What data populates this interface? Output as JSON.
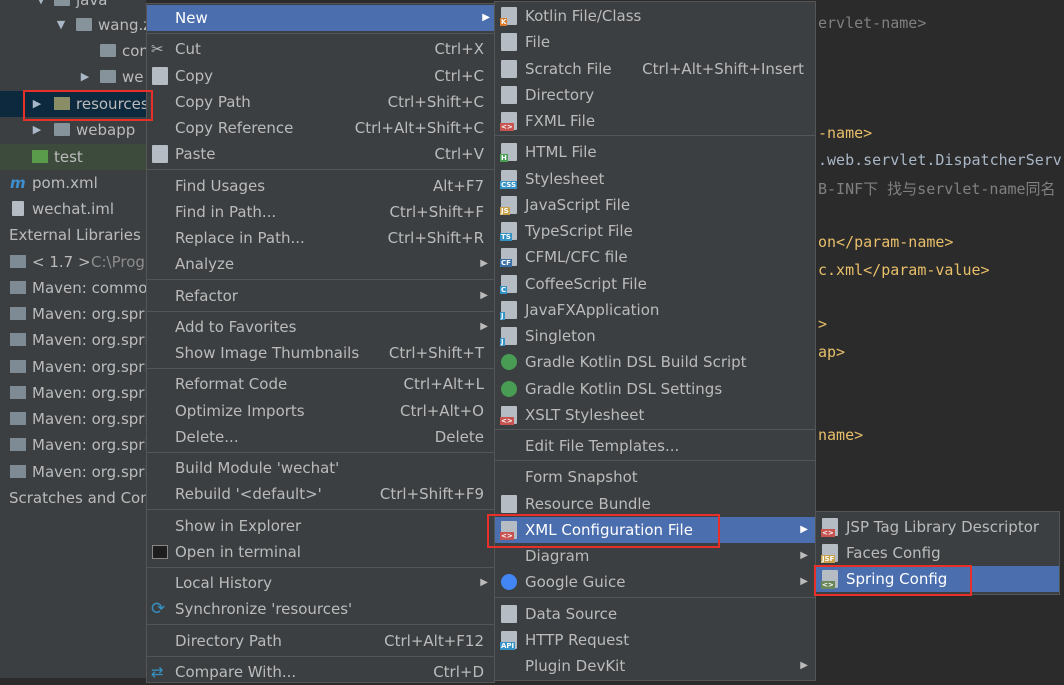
{
  "tree": {
    "rows": [
      {
        "label": "java"
      },
      {
        "label": "wang.z"
      },
      {
        "label": "con"
      },
      {
        "label": "we"
      },
      {
        "label": "resources"
      },
      {
        "label": "webapp"
      },
      {
        "label": "test"
      },
      {
        "label": "pom.xml",
        "prefix": "m"
      },
      {
        "label": "wechat.iml"
      },
      {
        "label": "External Libraries"
      },
      {
        "label": "< 1.7 >",
        "extra": "C:\\Prog"
      },
      {
        "label": "Maven: commo"
      },
      {
        "label": "Maven: org.spri"
      },
      {
        "label": "Maven: org.spri"
      },
      {
        "label": "Maven: org.spri"
      },
      {
        "label": "Maven: org.spri"
      },
      {
        "label": "Maven: org.spri"
      },
      {
        "label": "Maven: org.spri"
      },
      {
        "label": "Maven: org.spri"
      },
      {
        "label": "Scratches and Con"
      }
    ]
  },
  "editor": {
    "lines": [
      {
        "tag": "ervlet-name>",
        "text": ""
      },
      {
        "tag": "-name>",
        "text": ""
      },
      {
        "tag": "",
        "text": ".web.servlet.DispatcherServ"
      },
      {
        "tag": "",
        "text": "B-INF下 找与servlet-name同名"
      },
      {
        "tag": "",
        "text": "on</param-name>"
      },
      {
        "tag": "",
        "text": "c.xml</param-value>"
      },
      {
        "tag": ">",
        "text": ""
      },
      {
        "tag": "ap>",
        "text": ""
      },
      {
        "tag": "name>",
        "text": ""
      }
    ]
  },
  "context_menu": {
    "items": [
      {
        "label": "New",
        "shortcut": "",
        "submenu": true,
        "icon": ""
      },
      {
        "label": "Cut",
        "shortcut": "Ctrl+X",
        "icon": "scissors-icon"
      },
      {
        "label": "Copy",
        "shortcut": "Ctrl+C",
        "icon": "copy-icon"
      },
      {
        "label": "Copy Path",
        "shortcut": "Ctrl+Shift+C",
        "icon": ""
      },
      {
        "label": "Copy Reference",
        "shortcut": "Ctrl+Alt+Shift+C",
        "icon": ""
      },
      {
        "label": "Paste",
        "shortcut": "Ctrl+V",
        "icon": "paste-icon"
      },
      {
        "label": "Find Usages",
        "shortcut": "Alt+F7",
        "icon": ""
      },
      {
        "label": "Find in Path...",
        "shortcut": "Ctrl+Shift+F",
        "icon": ""
      },
      {
        "label": "Replace in Path...",
        "shortcut": "Ctrl+Shift+R",
        "icon": ""
      },
      {
        "label": "Analyze",
        "shortcut": "",
        "submenu": true,
        "icon": ""
      },
      {
        "label": "Refactor",
        "shortcut": "",
        "submenu": true,
        "icon": ""
      },
      {
        "label": "Add to Favorites",
        "shortcut": "",
        "submenu": true,
        "icon": ""
      },
      {
        "label": "Show Image Thumbnails",
        "shortcut": "Ctrl+Shift+T",
        "icon": ""
      },
      {
        "label": "Reformat Code",
        "shortcut": "Ctrl+Alt+L",
        "icon": ""
      },
      {
        "label": "Optimize Imports",
        "shortcut": "Ctrl+Alt+O",
        "icon": ""
      },
      {
        "label": "Delete...",
        "shortcut": "Delete",
        "icon": ""
      },
      {
        "label": "Build Module 'wechat'",
        "shortcut": "",
        "icon": ""
      },
      {
        "label": "Rebuild '<default>'",
        "shortcut": "Ctrl+Shift+F9",
        "icon": ""
      },
      {
        "label": "Show in Explorer",
        "shortcut": "",
        "icon": ""
      },
      {
        "label": "Open in terminal",
        "shortcut": "",
        "icon": "terminal-icon"
      },
      {
        "label": "Local History",
        "shortcut": "",
        "submenu": true,
        "icon": ""
      },
      {
        "label": "Synchronize 'resources'",
        "shortcut": "",
        "icon": "sync-icon"
      },
      {
        "label": "Directory Path",
        "shortcut": "Ctrl+Alt+F12",
        "icon": ""
      },
      {
        "label": "Compare With...",
        "shortcut": "Ctrl+D",
        "icon": "compare-icon"
      }
    ]
  },
  "new_menu": {
    "items": [
      {
        "label": "Kotlin File/Class",
        "shortcut": "",
        "tag": "K",
        "color": "#d97a2b"
      },
      {
        "label": "File",
        "shortcut": "",
        "tag": "",
        "color": "#b5bcc4"
      },
      {
        "label": "Scratch File",
        "shortcut": "Ctrl+Alt+Shift+Insert",
        "tag": "",
        "color": "#b5bcc4"
      },
      {
        "label": "Directory",
        "shortcut": "",
        "tag": "",
        "color": "#87939a"
      },
      {
        "label": "FXML File",
        "shortcut": "",
        "tag": "<>",
        "color": "#c75450"
      },
      {
        "label": "HTML File",
        "shortcut": "",
        "tag": "H",
        "color": "#499c54"
      },
      {
        "label": "Stylesheet",
        "shortcut": "",
        "tag": "CSS",
        "color": "#3592c4"
      },
      {
        "label": "JavaScript File",
        "shortcut": "",
        "tag": "JS",
        "color": "#c9a14a"
      },
      {
        "label": "TypeScript File",
        "shortcut": "",
        "tag": "TS",
        "color": "#3592c4"
      },
      {
        "label": "CFML/CFC file",
        "shortcut": "",
        "tag": "CF",
        "color": "#3a6ea5"
      },
      {
        "label": "CoffeeScript File",
        "shortcut": "",
        "tag": "C",
        "color": "#3592c4"
      },
      {
        "label": "JavaFXApplication",
        "shortcut": "",
        "tag": "J",
        "color": "#3592c4"
      },
      {
        "label": "Singleton",
        "shortcut": "",
        "tag": "J",
        "color": "#3592c4"
      },
      {
        "label": "Gradle Kotlin DSL Build Script",
        "shortcut": "",
        "tag": "G",
        "color": "#499c54"
      },
      {
        "label": "Gradle Kotlin DSL Settings",
        "shortcut": "",
        "tag": "G",
        "color": "#499c54"
      },
      {
        "label": "XSLT Stylesheet",
        "shortcut": "",
        "tag": "<>",
        "color": "#c75450"
      },
      {
        "label": "Edit File Templates...",
        "shortcut": "",
        "tag": "",
        "color": ""
      },
      {
        "label": "Form Snapshot",
        "shortcut": "",
        "tag": "",
        "color": ""
      },
      {
        "label": "Resource Bundle",
        "shortcut": "",
        "tag": "",
        "color": "#c75450"
      },
      {
        "label": "XML Configuration File",
        "shortcut": "",
        "tag": "<>",
        "color": "#c75450",
        "submenu": true
      },
      {
        "label": "Diagram",
        "shortcut": "",
        "tag": "",
        "color": "",
        "submenu": true
      },
      {
        "label": "Google Guice",
        "shortcut": "",
        "tag": "G",
        "color": "#4285f4",
        "submenu": true
      },
      {
        "label": "Data Source",
        "shortcut": "",
        "tag": "",
        "color": "#3592c4"
      },
      {
        "label": "HTTP Request",
        "shortcut": "",
        "tag": "API",
        "color": "#3592c4"
      },
      {
        "label": "Plugin DevKit",
        "shortcut": "",
        "tag": "",
        "color": "",
        "submenu": true
      }
    ]
  },
  "xml_menu": {
    "items": [
      {
        "label": "JSP Tag Library Descriptor",
        "tag": "<>",
        "color": "#c75450"
      },
      {
        "label": "Faces Config",
        "tag": "JSF",
        "color": "#c9a14a"
      },
      {
        "label": "Spring Config",
        "tag": "<>",
        "color": "#6a8759"
      }
    ]
  },
  "colors": {
    "highlight": "#4b6eaf",
    "menu_bg": "#3c3f41",
    "annotation": "#e8302a"
  }
}
